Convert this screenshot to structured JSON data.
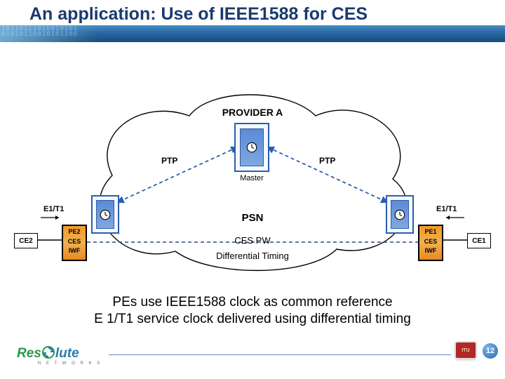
{
  "title": "An application: Use of IEEE1588 for CES",
  "provider": "PROVIDER A",
  "psn": "PSN",
  "ces_pw": "CES PW",
  "diff_timing": "Differential Timing",
  "master": "Master",
  "ptp": "PTP",
  "e1t1": "E1/T1",
  "ce1": "CE1",
  "ce2": "CE2",
  "pe1": {
    "l1": "PE1",
    "l2": "CES",
    "l3": "IWF"
  },
  "pe2": {
    "l1": "PE2",
    "l2": "CES",
    "l3": "IWF"
  },
  "caption1": "PEs use IEEE1588 clock as common reference",
  "caption2": "E 1/T1 service clock delivered using differential timing",
  "logo": {
    "res": "Res",
    "lute": "lute",
    "sub": "N E T W O R K S"
  },
  "itu": "ITU",
  "page": "12",
  "header_pattern": "10110111010010101\n01010110010101100"
}
